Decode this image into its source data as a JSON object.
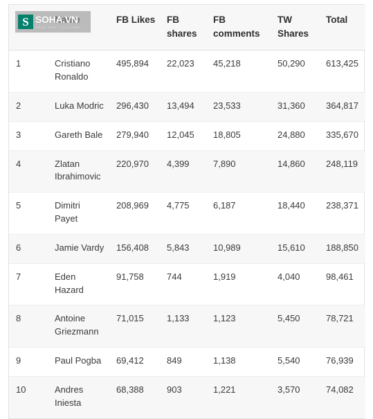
{
  "watermark": {
    "badge_letter": "S",
    "brand": "SOHA.VN",
    "tagline": "SỐNG MỚI - ĐA CHIỀU",
    "badge_color": "#04806c"
  },
  "table": {
    "columns": [
      {
        "key": "rank",
        "label": "Name"
      },
      {
        "key": "name",
        "label": ""
      },
      {
        "key": "fb_likes",
        "label": "FB Likes"
      },
      {
        "key": "fb_shares",
        "label": "FB shares"
      },
      {
        "key": "fb_comments",
        "label": "FB comments"
      },
      {
        "key": "tw_shares",
        "label": "TW Shares"
      },
      {
        "key": "total",
        "label": "Total"
      }
    ],
    "rows": [
      {
        "rank": "1",
        "name": "Cristiano Ronaldo",
        "fb_likes": "495,894",
        "fb_shares": "22,023",
        "fb_comments": "45,218",
        "tw_shares": "50,290",
        "total": "613,425"
      },
      {
        "rank": "2",
        "name": "Luka Modric",
        "fb_likes": "296,430",
        "fb_shares": "13,494",
        "fb_comments": "23,533",
        "tw_shares": "31,360",
        "total": "364,817"
      },
      {
        "rank": "3",
        "name": "Gareth Bale",
        "fb_likes": "279,940",
        "fb_shares": "12,045",
        "fb_comments": "18,805",
        "tw_shares": "24,880",
        "total": "335,670"
      },
      {
        "rank": "4",
        "name": "Zlatan Ibrahimovic",
        "fb_likes": "220,970",
        "fb_shares": "4,399",
        "fb_comments": "7,890",
        "tw_shares": "14,860",
        "total": "248,119"
      },
      {
        "rank": "5",
        "name": "Dimitri Payet",
        "fb_likes": "208,969",
        "fb_shares": "4,775",
        "fb_comments": "6,187",
        "tw_shares": "18,440",
        "total": "238,371"
      },
      {
        "rank": "6",
        "name": "Jamie Vardy",
        "fb_likes": "156,408",
        "fb_shares": "5,843",
        "fb_comments": "10,989",
        "tw_shares": "15,610",
        "total": "188,850"
      },
      {
        "rank": "7",
        "name": "Eden Hazard",
        "fb_likes": "91,758",
        "fb_shares": "744",
        "fb_comments": "1,919",
        "tw_shares": "4,040",
        "total": "98,461"
      },
      {
        "rank": "8",
        "name": "Antoine Griezmann",
        "fb_likes": "71,015",
        "fb_shares": "1,133",
        "fb_comments": "1,123",
        "tw_shares": "5,450",
        "total": "78,721"
      },
      {
        "rank": "9",
        "name": "Paul Pogba",
        "fb_likes": "69,412",
        "fb_shares": "849",
        "fb_comments": "1,138",
        "tw_shares": "5,540",
        "total": "76,939"
      },
      {
        "rank": "10",
        "name": "Andres Iniesta",
        "fb_likes": "68,388",
        "fb_shares": "903",
        "fb_comments": "1,221",
        "tw_shares": "3,570",
        "total": "74,082"
      }
    ]
  }
}
